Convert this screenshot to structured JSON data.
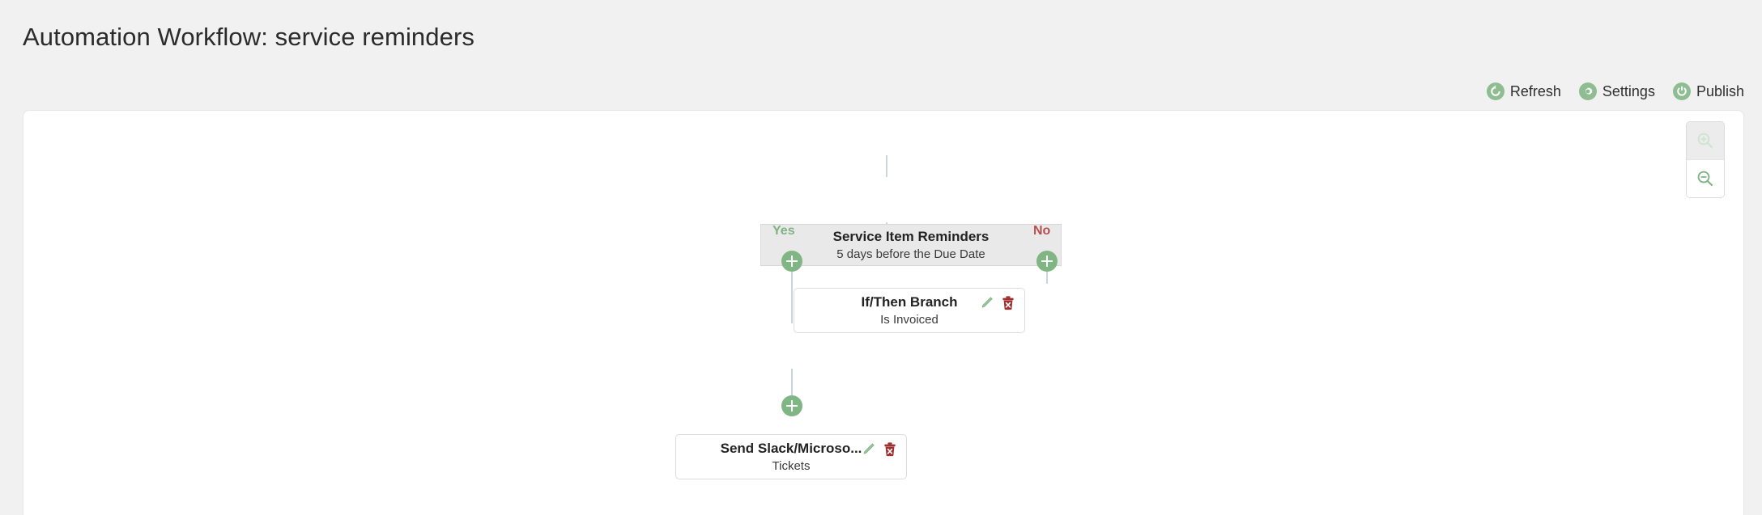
{
  "header": {
    "title": "Automation Workflow: service reminders"
  },
  "toolbar": {
    "buttons": [
      {
        "label": "Refresh",
        "icon": "refresh-icon"
      },
      {
        "label": "Settings",
        "icon": "gear-icon"
      },
      {
        "label": "Publish",
        "icon": "power-icon"
      }
    ]
  },
  "canvas": {
    "zoom_controls": {
      "zoom_in": {
        "icon": "zoom-in-icon",
        "enabled": false
      },
      "zoom_out": {
        "icon": "zoom-out-icon",
        "enabled": true
      }
    },
    "nodes": [
      {
        "id": "trigger",
        "title": "Service Item Reminders",
        "subtitle": "5 days before the Due Date",
        "type": "trigger"
      },
      {
        "id": "branch",
        "title": "If/Then Branch",
        "subtitle": "Is Invoiced",
        "type": "condition",
        "edit_icon": "pencil-icon",
        "delete_icon": "trash-icon"
      },
      {
        "id": "action",
        "title": "Send Slack/Microso...",
        "subtitle": "Tickets",
        "type": "action",
        "edit_icon": "pencil-icon",
        "delete_icon": "trash-icon"
      }
    ],
    "branch_labels": {
      "yes": "Yes",
      "no": "No"
    },
    "add_buttons": [
      {
        "id": "add-yes-branch"
      },
      {
        "id": "add-no-branch"
      },
      {
        "id": "add-after-action"
      }
    ]
  },
  "colors": {
    "accent_green": "#80b584",
    "danger_red": "#b5504f",
    "connector": "#ccd4de",
    "page_background": "#f1f1f1",
    "canvas_background": "#ffffff",
    "trigger_node_background": "#e9e9e9"
  }
}
